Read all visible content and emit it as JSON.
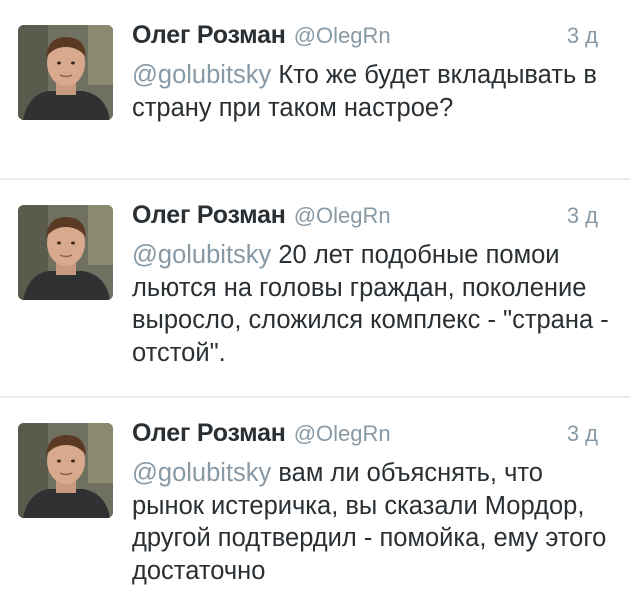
{
  "tweets": [
    {
      "author": "Олег Розман",
      "handle": "@OlegRn",
      "time": "3 д",
      "mention": "@golubitsky",
      "text": "Кто же будет вкладывать в страну при таком настрое?"
    },
    {
      "author": "Олег Розман",
      "handle": "@OlegRn",
      "time": "3 д",
      "mention": "@golubitsky",
      "text": "20 лет подобные помои льются на головы граждан, поколение выросло, сложился комплекс - \"страна - отстой\"."
    },
    {
      "author": "Олег Розман",
      "handle": "@OlegRn",
      "time": "3 д",
      "mention": "@golubitsky",
      "text": "вам ли объяснять, что рынок истеричка, вы сказали Мордор, другой подтвердил - помойка, ему этого достаточно"
    }
  ],
  "colors": {
    "text": "#292f33",
    "muted": "#8899a6",
    "divider": "#e6ecf0"
  }
}
